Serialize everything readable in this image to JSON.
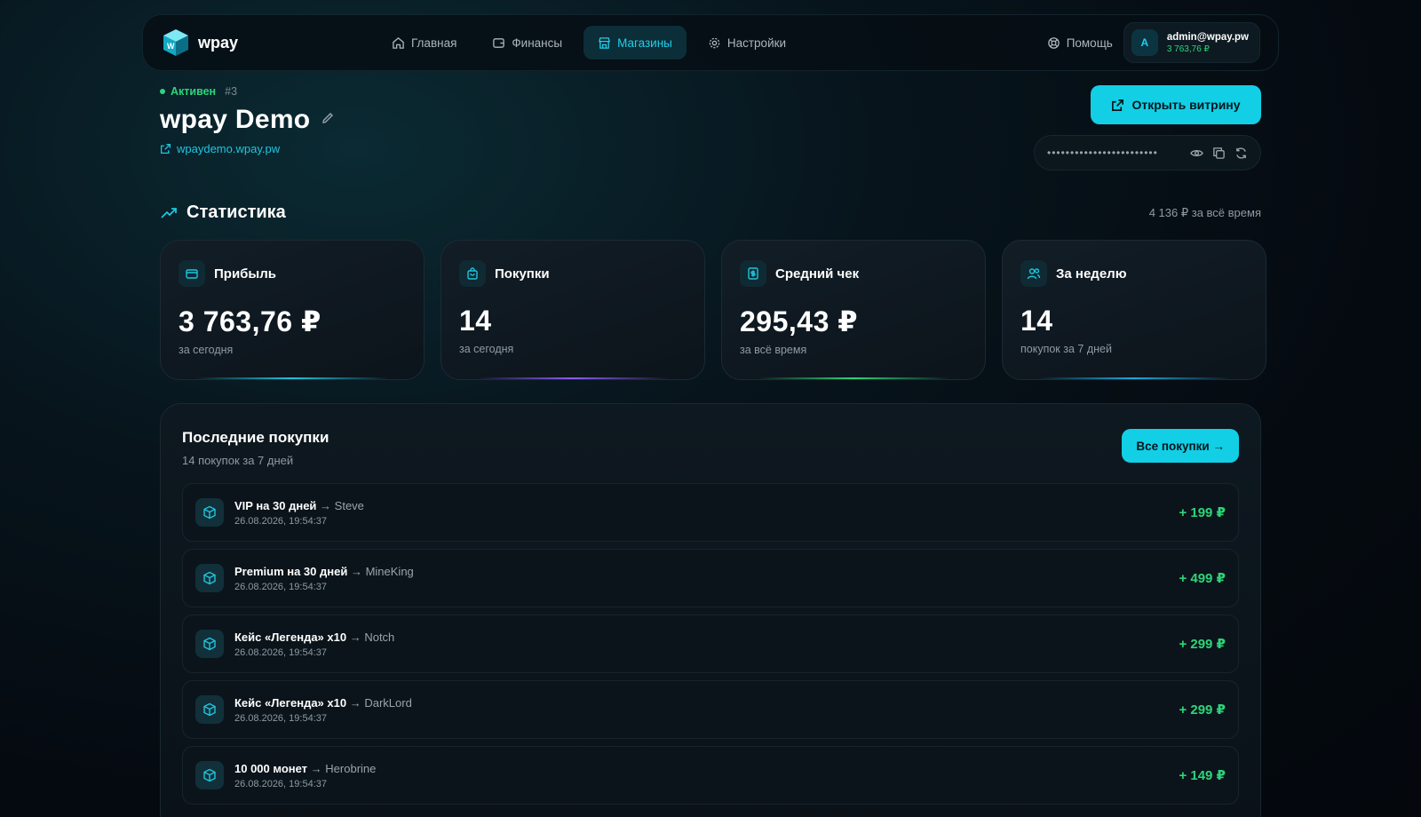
{
  "nav": {
    "brand": "wpay",
    "links": [
      {
        "label": "Главная",
        "icon": "home-icon"
      },
      {
        "label": "Финансы",
        "icon": "wallet-icon"
      },
      {
        "label": "Магазины",
        "icon": "store-icon",
        "active": true
      },
      {
        "label": "Настройки",
        "icon": "gear-icon"
      }
    ],
    "help": "Помощь",
    "user": {
      "initial": "A",
      "email": "admin@wpay.pw",
      "balance": "3 763,76 ₽"
    }
  },
  "store": {
    "status": "Активен",
    "number": "#3",
    "title": "wpay Demo",
    "link": "wpaydemo.wpay.pw",
    "open_button": "Открыть витрину",
    "token_masked": "••••••••••••••••••••••••"
  },
  "stats": {
    "title": "Статистика",
    "total": "4 136 ₽ за всё время",
    "cards": [
      {
        "label": "Прибыль",
        "value": "3 763,76 ₽",
        "sub": "за сегодня",
        "icon": "card-icon",
        "accent": "#1fc5de"
      },
      {
        "label": "Покупки",
        "value": "14",
        "sub": "за сегодня",
        "icon": "bag-icon",
        "accent": "#8b5cf6"
      },
      {
        "label": "Средний чек",
        "value": "295,43 ₽",
        "sub": "за всё время",
        "icon": "receipt-icon",
        "accent": "#2ed47a"
      },
      {
        "label": "За неделю",
        "value": "14",
        "sub": "покупок за 7 дней",
        "icon": "users-icon",
        "accent": "#1fa8de"
      }
    ]
  },
  "recent": {
    "title": "Последние покупки",
    "subtitle": "14 покупок за 7 дней",
    "all_button": "Все покупки →",
    "rows": [
      {
        "item": "VIP на 30 дней",
        "buyer": "→ Steve",
        "date": "26.08.2026, 19:54:37",
        "amount": "+ 199 ₽"
      },
      {
        "item": "Premium на 30 дней",
        "buyer": "→ MineKing",
        "date": "26.08.2026, 19:54:37",
        "amount": "+ 499 ₽"
      },
      {
        "item": "Кейс «Легенда» x10",
        "buyer": "→ Notch",
        "date": "26.08.2026, 19:54:37",
        "amount": "+ 299 ₽"
      },
      {
        "item": "Кейс «Легенда» x10",
        "buyer": "→ DarkLord",
        "date": "26.08.2026, 19:54:37",
        "amount": "+ 299 ₽"
      },
      {
        "item": "10 000 монет",
        "buyer": "→ Herobrine",
        "date": "26.08.2026, 19:54:37",
        "amount": "+ 149 ₽"
      }
    ]
  },
  "colors": {
    "accent": "#12cfe6",
    "success": "#2ed47a",
    "background": "#050a10"
  }
}
